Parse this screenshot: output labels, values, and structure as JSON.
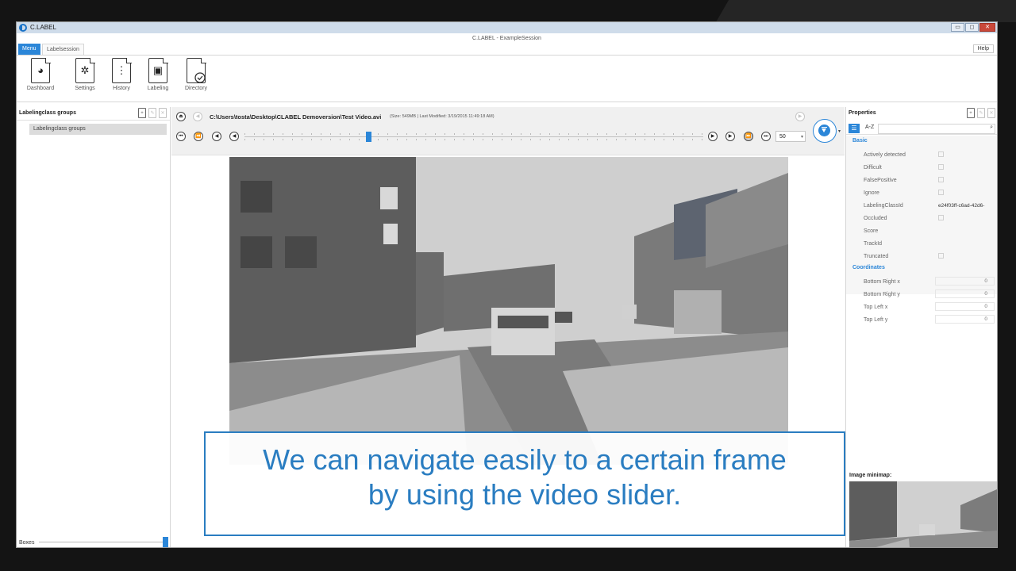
{
  "window": {
    "app_name": "C.LABEL",
    "subtitle": "C.LABEL - ExampleSession",
    "controls": {
      "minimize": "▭",
      "restore": "◻",
      "close": "✕"
    }
  },
  "tabs": {
    "menu": "Menu",
    "labelsession": "Labelsession",
    "help": "Help"
  },
  "ribbon": {
    "items": [
      {
        "label": "Dashboard",
        "icon": "pie-chart-icon",
        "glyph": "◕"
      },
      {
        "label": "Settings",
        "icon": "gear-icon",
        "glyph": "✲"
      },
      {
        "label": "History",
        "icon": "zipper-icon",
        "glyph": "⋮"
      },
      {
        "label": "Labeling",
        "icon": "image-icon",
        "glyph": "▣"
      },
      {
        "label": "Directory",
        "icon": "folder-check-icon",
        "glyph": ""
      }
    ]
  },
  "left_panel": {
    "title": "Labelingclass groups",
    "item": "Labelingclass groups",
    "boxes_label": "Boxes",
    "icons": [
      "+",
      "✎",
      "✕"
    ]
  },
  "toolbar": {
    "file_path": "C:\\Users\\tosta\\Desktop\\CLABEL Demoversion\\Test Video.avi",
    "file_info": "(Size: 549MB | Last Modified: 3/19/2015 11:49:18 AM)",
    "frame_step": "50",
    "glyphs": {
      "eject": "⏏",
      "prev": "◀",
      "next": "▶",
      "first": "⏮",
      "rewind": "⏪",
      "step_back": "◀",
      "play_back": "◀",
      "play": "▶",
      "step_fwd": "▶",
      "fast_fwd": "⏩",
      "last": "⏭",
      "spin_arrow": "▾",
      "dropdown_arrow": "▾"
    }
  },
  "caption": {
    "line1": "We can navigate easily to a certain frame",
    "line2": "by using the video slider."
  },
  "properties": {
    "title": "Properties",
    "sort_label": "A-Z",
    "category_glyph": "☰",
    "search_glyph": "⌕",
    "icons": [
      "+",
      "✎",
      "✕"
    ],
    "basic_group": "Basic",
    "basic_rows": [
      {
        "key": "Actively detected",
        "type": "checkbox",
        "value": ""
      },
      {
        "key": "Difficult",
        "type": "checkbox",
        "value": ""
      },
      {
        "key": "FalsePositive",
        "type": "checkbox",
        "value": ""
      },
      {
        "key": "Ignore",
        "type": "checkbox",
        "value": ""
      },
      {
        "key": "LabelingClassId",
        "type": "text",
        "value": "e24f03ff-c6ad-42d6-"
      },
      {
        "key": "Occluded",
        "type": "checkbox",
        "value": ""
      },
      {
        "key": "Score",
        "type": "text",
        "value": ""
      },
      {
        "key": "TrackId",
        "type": "text",
        "value": ""
      },
      {
        "key": "Truncated",
        "type": "checkbox",
        "value": ""
      }
    ],
    "coord_group": "Coordinates",
    "coord_rows": [
      {
        "key": "Bottom Right x",
        "value": "0"
      },
      {
        "key": "Bottom Right y",
        "value": "0"
      },
      {
        "key": "Top Left x",
        "value": "0"
      },
      {
        "key": "Top Left y",
        "value": "0"
      }
    ],
    "minimap_label": "Image minimap:"
  },
  "colors": {
    "accent": "#2b86d8",
    "caption": "#2a7dc1"
  }
}
